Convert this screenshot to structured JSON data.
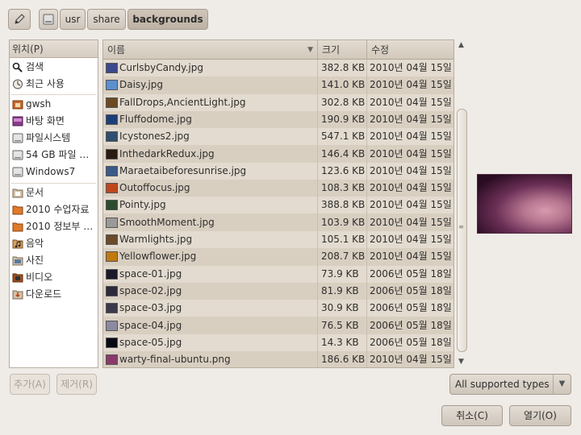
{
  "path_bar": {
    "edit_icon": "pencil-icon",
    "root_icon": "drive-icon",
    "crumbs": [
      "usr",
      "share",
      "backgrounds"
    ]
  },
  "sidebar": {
    "header": "위치(P)",
    "items": [
      {
        "label": "검색",
        "icon": "search-icon"
      },
      {
        "label": "최근 사용",
        "icon": "recent-icon"
      },
      {
        "label": "gwsh",
        "icon": "home-folder-icon"
      },
      {
        "label": "바탕 화면",
        "icon": "desktop-icon"
      },
      {
        "label": "파일시스템",
        "icon": "filesystem-icon"
      },
      {
        "label": "54 GB 파일 …",
        "icon": "drive-icon"
      },
      {
        "label": "Windows7",
        "icon": "drive-icon"
      },
      {
        "label": "문서",
        "icon": "documents-folder-icon"
      },
      {
        "label": "2010 수업자료",
        "icon": "folder-icon"
      },
      {
        "label": "2010 정보부 …",
        "icon": "folder-icon"
      },
      {
        "label": "음악",
        "icon": "music-folder-icon"
      },
      {
        "label": "사진",
        "icon": "pictures-folder-icon"
      },
      {
        "label": "비디오",
        "icon": "videos-folder-icon"
      },
      {
        "label": "다운로드",
        "icon": "downloads-folder-icon"
      }
    ]
  },
  "filelist": {
    "columns": {
      "name": "이름",
      "size": "크기",
      "modified": "수정"
    },
    "sort_indicator": "▼",
    "files": [
      {
        "name": "CurlsbyCandy.jpg",
        "size": "382.8 KB",
        "modified": "2010년 04월 15일",
        "thumb": "#3a4a8c"
      },
      {
        "name": "Daisy.jpg",
        "size": "141.0 KB",
        "modified": "2010년 04월 15일",
        "thumb": "#5a8fd0"
      },
      {
        "name": "FallDrops,AncientLight.jpg",
        "size": "302.8 KB",
        "modified": "2010년 04월 15일",
        "thumb": "#6b4a20"
      },
      {
        "name": "Fluffodome.jpg",
        "size": "190.9 KB",
        "modified": "2010년 04월 15일",
        "thumb": "#1c3f7a"
      },
      {
        "name": "Icystones2.jpg",
        "size": "547.1 KB",
        "modified": "2010년 04월 15일",
        "thumb": "#2f4f6f"
      },
      {
        "name": "InthedarkRedux.jpg",
        "size": "146.4 KB",
        "modified": "2010년 04월 15일",
        "thumb": "#2a1a10"
      },
      {
        "name": "Maraetaibeforesunrise.jpg",
        "size": "123.6 KB",
        "modified": "2010년 04월 15일",
        "thumb": "#3a5a8a"
      },
      {
        "name": "Outoffocus.jpg",
        "size": "108.3 KB",
        "modified": "2010년 04월 15일",
        "thumb": "#c0471c"
      },
      {
        "name": "Pointy.jpg",
        "size": "388.8 KB",
        "modified": "2010년 04월 15일",
        "thumb": "#2c4c2c"
      },
      {
        "name": "SmoothMoment.jpg",
        "size": "103.9 KB",
        "modified": "2010년 04월 15일",
        "thumb": "#9a9a9a"
      },
      {
        "name": "Warmlights.jpg",
        "size": "105.1 KB",
        "modified": "2010년 04월 15일",
        "thumb": "#6a4a2a"
      },
      {
        "name": "Yellowflower.jpg",
        "size": "208.7 KB",
        "modified": "2010년 04월 15일",
        "thumb": "#c07a10"
      },
      {
        "name": "space-01.jpg",
        "size": "73.9 KB",
        "modified": "2006년 05월 18일",
        "thumb": "#1a1a2a"
      },
      {
        "name": "space-02.jpg",
        "size": "81.9 KB",
        "modified": "2006년 05월 18일",
        "thumb": "#2a2a3a"
      },
      {
        "name": "space-03.jpg",
        "size": "30.9 KB",
        "modified": "2006년 05월 18일",
        "thumb": "#3a3a4a"
      },
      {
        "name": "space-04.jpg",
        "size": "76.5 KB",
        "modified": "2006년 05월 18일",
        "thumb": "#8a8aa0"
      },
      {
        "name": "space-05.jpg",
        "size": "14.3 KB",
        "modified": "2006년 05월 18일",
        "thumb": "#0a0a14"
      },
      {
        "name": "warty-final-ubuntu.png",
        "size": "186.6 KB",
        "modified": "2010년 04월 15일",
        "thumb": "#8a3a6a"
      }
    ]
  },
  "bottom": {
    "add_label": "추가(A)",
    "remove_label": "제거(R)",
    "filter_value": "All supported types",
    "cancel_label": "취소(C)",
    "open_label": "열기(O)"
  }
}
